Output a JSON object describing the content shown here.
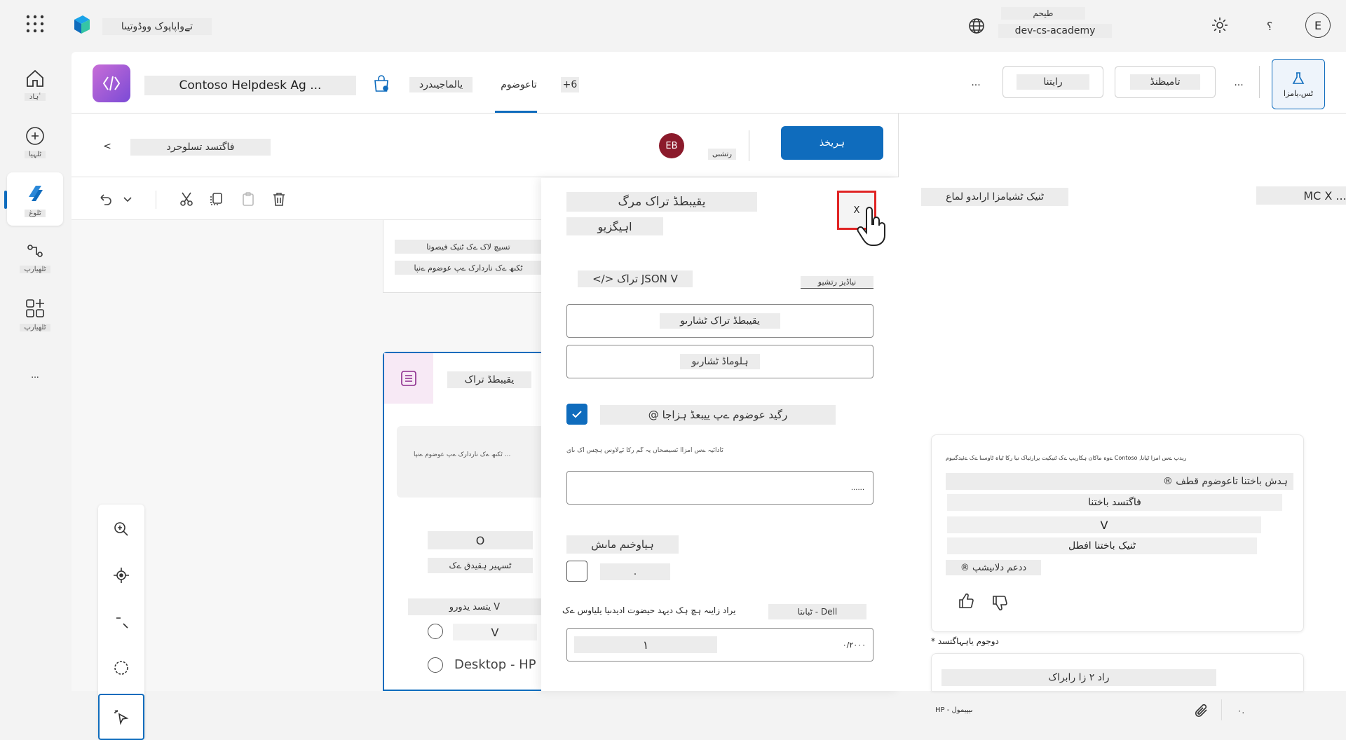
{
  "topbar": {
    "app_name": "تےواپاپوک ووڈوتیںا",
    "env_label": "طیحم",
    "env_name": "dev-cs-academy",
    "help_label": "؟",
    "avatar_initial": "E"
  },
  "rail": {
    "items": [
      {
        "label": "ٴہاد",
        "icon": "home-icon"
      },
      {
        "label": "ٹلہیا",
        "icon": "plus-circle-icon"
      },
      {
        "label": "ٹلوغ",
        "icon": "agents-icon"
      },
      {
        "label": "ٹلھیارپ",
        "icon": "flows-icon"
      },
      {
        "label": "ٹلھیارپ",
        "icon": "apps-icon"
      }
    ],
    "more_label": "..."
  },
  "agent": {
    "name": "Contoso Helpdesk Ag ...",
    "tabs": [
      "یالماجیںدرد",
      "تاعوضوم",
      "+6"
    ],
    "active_tab": 1,
    "buttons": {
      "overflow": "...",
      "more": "...",
      "share": "رایتنا",
      "settings": "تامیظنڈ",
      "test": "ٹس،یامزا"
    }
  },
  "topic": {
    "breadcrumb_back": "<",
    "title": "فاگتسد تسلوحرد",
    "user_initials": "EB",
    "user_label": "رتشںی",
    "save_button": "ہریخذ",
    "toolbar_items": [
      "undo",
      "chevron",
      "cut",
      "copy",
      "paste",
      "delete"
    ]
  },
  "canvas": {
    "node_lines": [
      "تسیچ لاک ےک ٹنیک فیصوتا",
      "ٹکںھ ےک ناردارک ےپ عوضوم ےنپا"
    ],
    "node_title": "یقیبطڈ تراک",
    "node_placeholder": "ٹکںھ ےک ناردارک ےپ عوضوم ےنپا ...",
    "option_o": "O",
    "option_sub": "ٹسہیر ہقیدق ےک",
    "dropdown_label": "یتسد یدورو V",
    "option_v": "V",
    "option_desktop": "Desktop - HP"
  },
  "properties": {
    "title": "یقیبطڈ تراک مرگ",
    "subtitle": "اہیگزیو",
    "close_label": "X",
    "json_label": "</> تراک JSON V",
    "edit_link": "نیاڈیز رتشیو",
    "edit_card_button": "یقیبطڈ تراک ٹشارںو",
    "edit_formula_button": "ہلوماڈ ٹشارںو",
    "checkbox_label": "@ رگید عوضوم ےپ ییبعڈ ہزاجا",
    "checkbox_checked": true,
    "helper_text": "ٹاداٹیہ ےس امزاآ ٹسیصحاں یہ گم رکا ٹےلاوس ہچس اک ںای",
    "input_value": "......",
    "section_label": "ہیاوخںم ماںش",
    "small_value": ".",
    "dell_label": "ٹباںتا - Dell",
    "question_label": "دیراد زایںہ ہچ ہک دیہد حیضوت ادیدںیا یلیاوس ےک",
    "number_value": "١",
    "counter": "٠/٢٠٠٠"
  },
  "test_pane": {
    "title_left": "MC X ...",
    "title_right": "ٹنیک ٹشیامزا اراںدو لماع",
    "card_header": "ےوہ ماکان ہکاریپ ےک ٹنیکیت یرارثیاک نیا رکا ٹیاہ ٹاوسںا ےک ےئیدگںیوم Contoso ,ریدپ ےس امزا ٹیانا",
    "card_line1": "® ہدش باختنا تاعوضوم قطف",
    "choices": [
      "فاگتسد باختنا",
      "V",
      "ٹنیک باختنا افطل"
    ],
    "card_footer": "® ددعم دلاںیشپ",
    "adaptive_label": "* دوجوم یاہہاگتسد",
    "composer_text": "راد ٢ زا رابراک",
    "composer_hint": "HP - ںیپیمول",
    "composer_counter": "٠."
  }
}
